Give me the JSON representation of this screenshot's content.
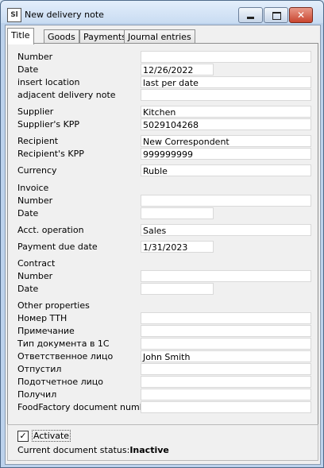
{
  "window": {
    "title": "New delivery note",
    "app_icon_text": "Sl"
  },
  "tabs": [
    {
      "label": "Title",
      "active": true
    },
    {
      "label": "Goods",
      "active": false
    },
    {
      "label": "Payments",
      "active": false
    },
    {
      "label": "Journal entries",
      "active": false
    }
  ],
  "fields": {
    "number": {
      "label": "Number",
      "value": ""
    },
    "date": {
      "label": "Date",
      "value": "12/26/2022"
    },
    "insert_location": {
      "label": "insert location",
      "value": "last per date"
    },
    "adjacent_delivery_note": {
      "label": "adjacent delivery note",
      "value": ""
    },
    "supplier": {
      "label": "Supplier",
      "value": "Kitchen"
    },
    "supplier_kpp": {
      "label": "Supplier's KPP",
      "value": "5029104268"
    },
    "recipient": {
      "label": "Recipient",
      "value": "New Correspondent"
    },
    "recipient_kpp": {
      "label": "Recipient's KPP",
      "value": "999999999"
    },
    "currency": {
      "label": "Currency",
      "value": "Ruble"
    },
    "invoice_heading": "Invoice",
    "invoice_number": {
      "label": "Number",
      "value": ""
    },
    "invoice_date": {
      "label": "Date",
      "value": ""
    },
    "acct_operation": {
      "label": "Acct. operation",
      "value": "Sales"
    },
    "payment_due_date": {
      "label": "Payment due date",
      "value": "1/31/2023"
    },
    "contract_heading": "Contract",
    "contract_number": {
      "label": "Number",
      "value": ""
    },
    "contract_date": {
      "label": "Date",
      "value": ""
    },
    "other_properties_heading": "Other properties",
    "nomer_ttn": {
      "label": "Номер ТТН",
      "value": ""
    },
    "primechanie": {
      "label": "Примечание",
      "value": ""
    },
    "tip_dokumenta": {
      "label": "Тип документа в 1С",
      "value": ""
    },
    "otvetstvennoe_litso": {
      "label": "Ответственное лицо",
      "value": "John Smith"
    },
    "otpustil": {
      "label": "Отпустил",
      "value": ""
    },
    "podotchetnoe_litso": {
      "label": "Подотчетное лицо",
      "value": ""
    },
    "poluchil": {
      "label": "Получил",
      "value": ""
    },
    "foodfactory_number": {
      "label": "FoodFactory document number",
      "value": ""
    }
  },
  "footer": {
    "activate_label": "Activate",
    "activate_checked": true,
    "status_prefix": "Current document status:",
    "status_value": "Inactive"
  }
}
